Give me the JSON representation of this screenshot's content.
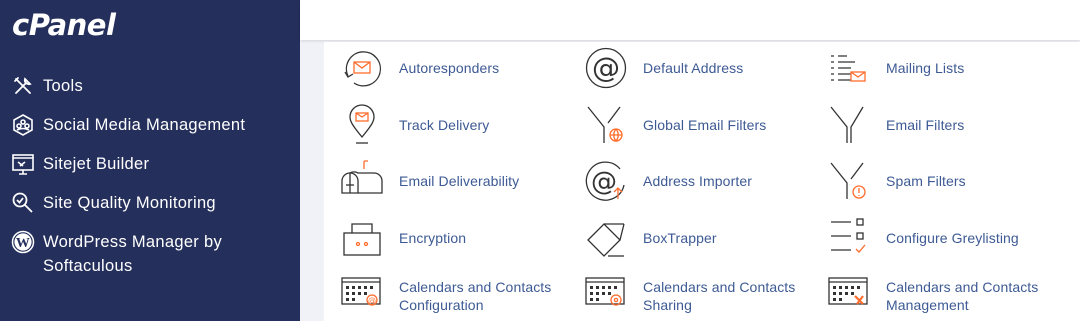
{
  "brand": {
    "logo_text": "cPanel"
  },
  "sidebar": {
    "items": [
      {
        "label": "Tools",
        "icon": "tools-icon"
      },
      {
        "label": "Social Media Management",
        "icon": "social-media-icon"
      },
      {
        "label": "Sitejet Builder",
        "icon": "sitejet-icon"
      },
      {
        "label": "Site Quality Monitoring",
        "icon": "site-quality-icon"
      },
      {
        "label": "WordPress Manager by",
        "label_line2": "Softaculous",
        "icon": "wordpress-icon"
      }
    ]
  },
  "email_tools": {
    "rows": [
      [
        {
          "label": "Autoresponders",
          "icon": "autoresponders-icon"
        },
        {
          "label": "Default Address",
          "icon": "default-address-icon"
        },
        {
          "label": "Mailing Lists",
          "icon": "mailing-lists-icon"
        }
      ],
      [
        {
          "label": "Track Delivery",
          "icon": "track-delivery-icon"
        },
        {
          "label": "Global Email Filters",
          "icon": "global-email-filters-icon"
        },
        {
          "label": "Email Filters",
          "icon": "email-filters-icon"
        }
      ],
      [
        {
          "label": "Email Deliverability",
          "icon": "email-deliverability-icon"
        },
        {
          "label": "Address Importer",
          "icon": "address-importer-icon"
        },
        {
          "label": "Spam Filters",
          "icon": "spam-filters-icon"
        }
      ],
      [
        {
          "label": "Encryption",
          "icon": "encryption-icon"
        },
        {
          "label": "BoxTrapper",
          "icon": "boxtrapper-icon"
        },
        {
          "label": "Configure Greylisting",
          "icon": "greylisting-icon"
        }
      ],
      [
        {
          "label": "Calendars and Contacts",
          "label_line2": "Configuration",
          "icon": "calendars-config-icon"
        },
        {
          "label": "Calendars and Contacts",
          "label_line2": "Sharing",
          "icon": "calendars-sharing-icon"
        },
        {
          "label": "Calendars and Contacts",
          "label_line2": "Management",
          "icon": "calendars-management-icon"
        }
      ]
    ]
  },
  "colors": {
    "sidebar_bg": "#242f5b",
    "link": "#3d5a94",
    "icon_stroke": "#333333",
    "accent": "#ff6c2c"
  }
}
